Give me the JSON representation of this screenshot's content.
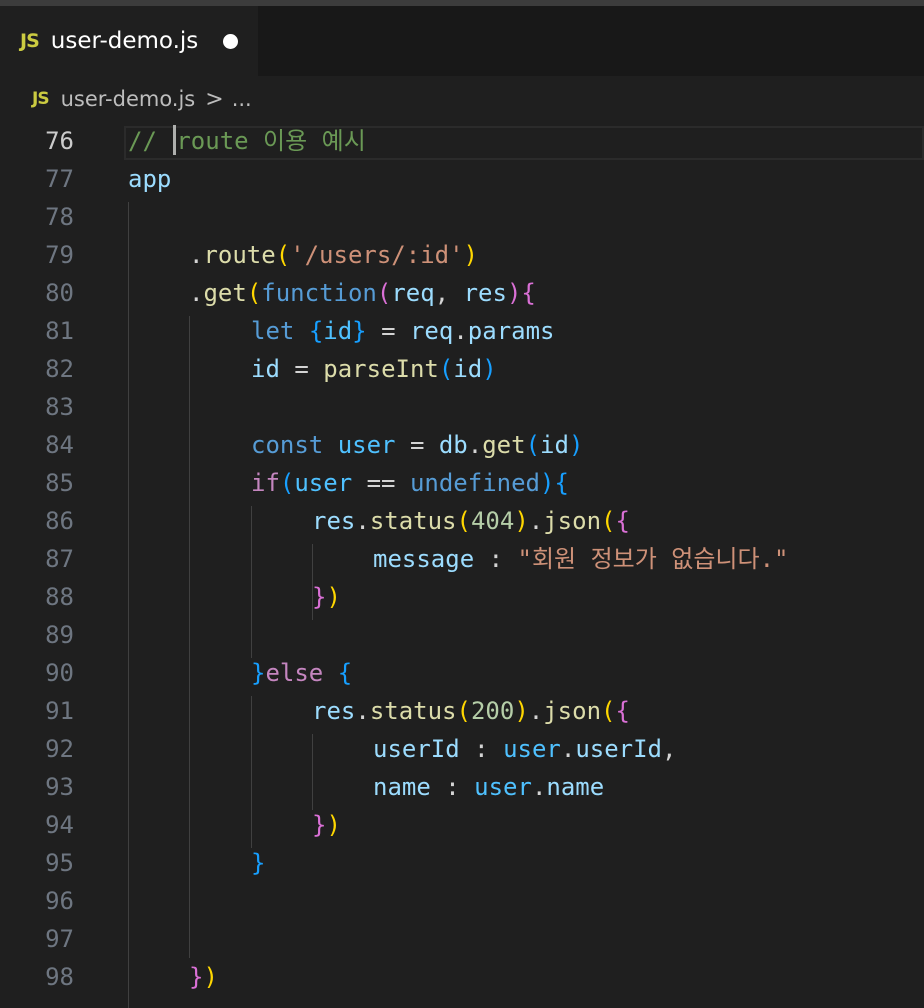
{
  "tab": {
    "icon": "JS",
    "filename": "user-demo.js"
  },
  "breadcrumb": {
    "icon": "JS",
    "file": "user-demo.js",
    "separator": ">",
    "more": "..."
  },
  "editor": {
    "line_numbers": [
      "76",
      "77",
      "78",
      "79",
      "80",
      "81",
      "82",
      "83",
      "84",
      "85",
      "86",
      "87",
      "88",
      "89",
      "90",
      "91",
      "92",
      "93",
      "94",
      "95",
      "96",
      "97",
      "98"
    ],
    "active_line": "76",
    "tokens": {
      "l76_comment_a": "// ",
      "l76_comment_b": "route 이용 예시",
      "l77_app": "app",
      "l79_dot": ".",
      "l79_route": "route",
      "l79_open": "(",
      "l79_str": "'/users/:id'",
      "l79_close": ")",
      "l80_dot": ".",
      "l80_get": "get",
      "l80_open": "(",
      "l80_function": "function",
      "l80_open2": "(",
      "l80_req": "req",
      "l80_comma": ", ",
      "l80_res": "res",
      "l80_close2": ")",
      "l80_brace": "{",
      "l81_let": "let",
      "l81_ob": "{",
      "l81_id": "id",
      "l81_cb": "}",
      "l81_eq": " = ",
      "l81_req": "req",
      "l81_dot": ".",
      "l81_params": "params",
      "l82_id": "id",
      "l82_eq": " = ",
      "l82_parseInt": "parseInt",
      "l82_open": "(",
      "l82_arg": "id",
      "l82_close": ")",
      "l84_const": "const",
      "l84_user": "user",
      "l84_eq": " = ",
      "l84_db": "db",
      "l84_dot": ".",
      "l84_get": "get",
      "l84_open": "(",
      "l84_id": "id",
      "l84_close": ")",
      "l85_if": "if",
      "l85_open": "(",
      "l85_user": "user",
      "l85_op": " == ",
      "l85_undefined": "undefined",
      "l85_close": ")",
      "l85_brace": "{",
      "l86_res": "res",
      "l86_dot": ".",
      "l86_status": "status",
      "l86_open": "(",
      "l86_num": "404",
      "l86_close": ")",
      "l86_dot2": ".",
      "l86_json": "json",
      "l86_open2": "(",
      "l86_brace": "{",
      "l87_message": "message",
      "l87_colon": " : ",
      "l87_str": "\"회원 정보가 없습니다.\"",
      "l88_brace": "}",
      "l88_close": ")",
      "l90_brace": "}",
      "l90_else": "else",
      "l90_space": " ",
      "l90_brace2": "{",
      "l91_res": "res",
      "l91_dot": ".",
      "l91_status": "status",
      "l91_open": "(",
      "l91_num": "200",
      "l91_close": ")",
      "l91_dot2": ".",
      "l91_json": "json",
      "l91_open2": "(",
      "l91_brace": "{",
      "l92_userId": "userId",
      "l92_colon": " : ",
      "l92_user": "user",
      "l92_dot": ".",
      "l92_prop": "userId",
      "l92_comma": ",",
      "l93_name": "name",
      "l93_colon": " : ",
      "l93_user": "user",
      "l93_dot": ".",
      "l93_prop": "name",
      "l94_brace": "}",
      "l94_close": ")",
      "l95_brace": "}",
      "l98_brace": "}",
      "l98_close": ")"
    }
  },
  "colors": {
    "editor_bg": "#1f1f1f",
    "comment": "#6a9955",
    "variable": "#9cdcfe",
    "function": "#dcdcaa",
    "string": "#ce9178",
    "keyword": "#569cd6",
    "control": "#c586c0",
    "number": "#b5cea8",
    "js_icon": "#cbcb41"
  }
}
